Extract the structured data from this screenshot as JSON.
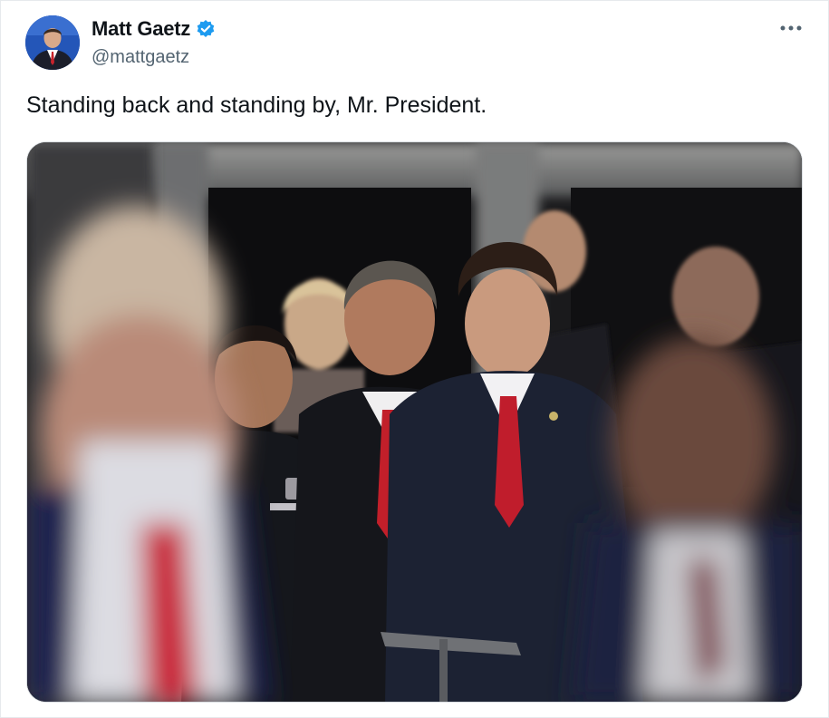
{
  "author": {
    "display_name": "Matt Gaetz",
    "handle": "@mattgaetz",
    "verified_icon": "verified-badge-icon",
    "avatar_icon": "avatar"
  },
  "menu": {
    "icon": "more-options-icon"
  },
  "tweet": {
    "text": "Standing back and standing by, Mr. President."
  },
  "media": {
    "type": "photo"
  },
  "colors": {
    "text_primary": "#0f1419",
    "text_secondary": "#536471",
    "verified_blue": "#1d9bf0"
  }
}
